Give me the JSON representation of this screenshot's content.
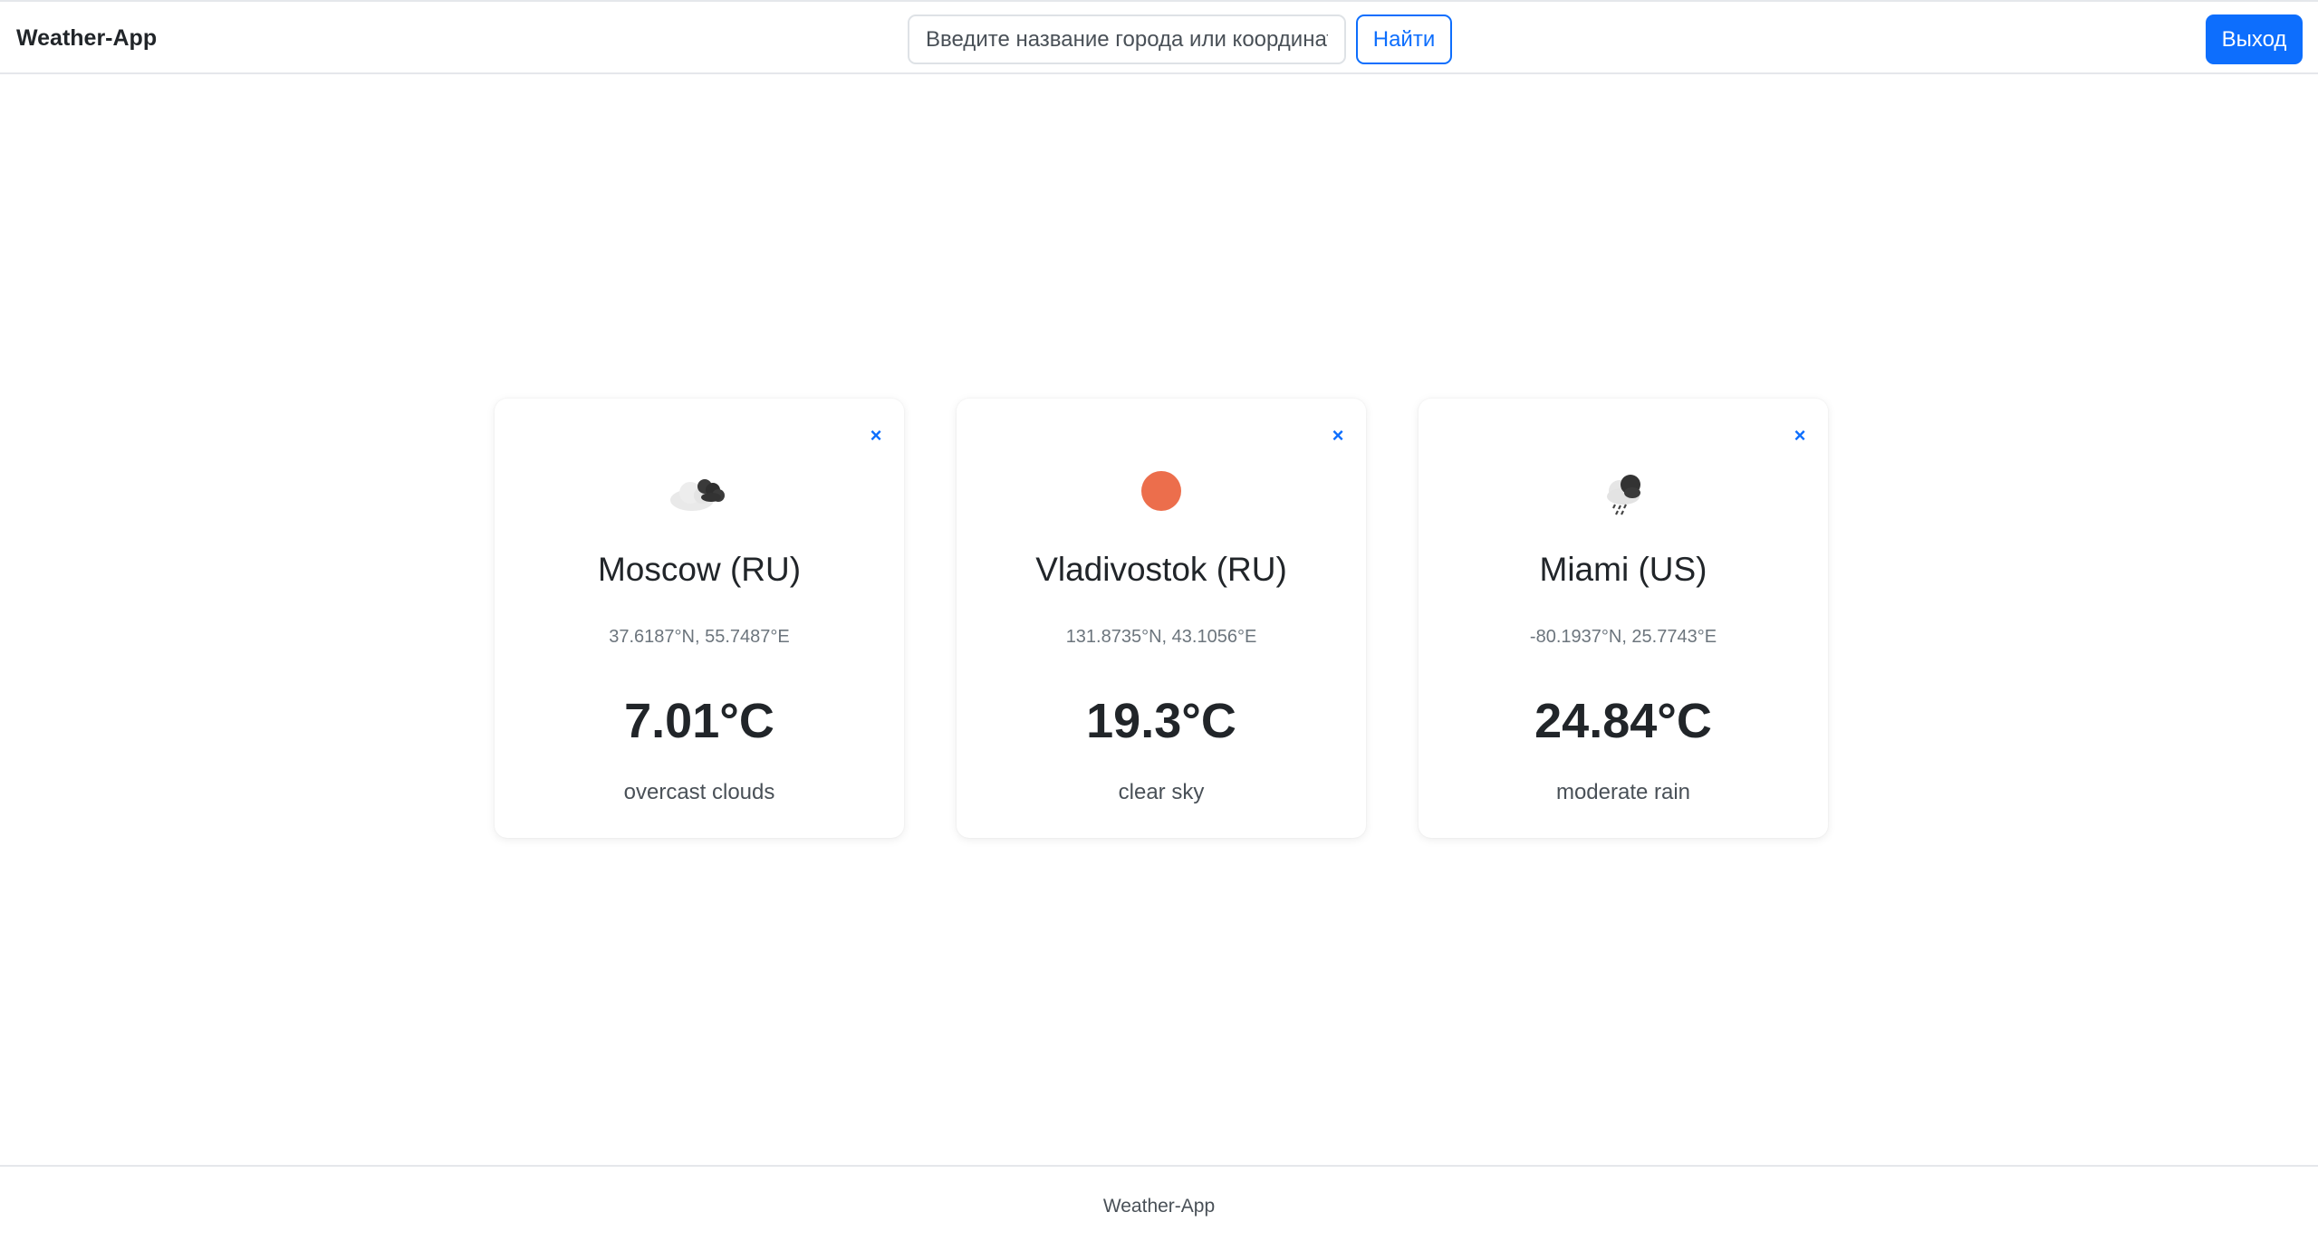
{
  "header": {
    "brand": "Weather-App",
    "search_placeholder": "Введите название города или координаты",
    "search_button": "Найти",
    "logout_button": "Выход"
  },
  "cards": [
    {
      "icon": "overcast-clouds-icon",
      "city": "Moscow (RU)",
      "coords": "37.6187°N, 55.7487°E",
      "temp": "7.01°C",
      "description": "overcast clouds",
      "close": "×"
    },
    {
      "icon": "clear-sky-sun-icon",
      "city": "Vladivostok (RU)",
      "coords": "131.8735°N, 43.1056°E",
      "temp": "19.3°C",
      "description": "clear sky",
      "close": "×"
    },
    {
      "icon": "rain-cloud-icon",
      "city": "Miami (US)",
      "coords": "-80.1937°N, 25.7743°E",
      "temp": "24.84°C",
      "description": "moderate rain",
      "close": "×"
    }
  ],
  "footer": {
    "text": "Weather-App"
  },
  "colors": {
    "accent": "#0d6efd",
    "sun": "#ec6e4c"
  }
}
